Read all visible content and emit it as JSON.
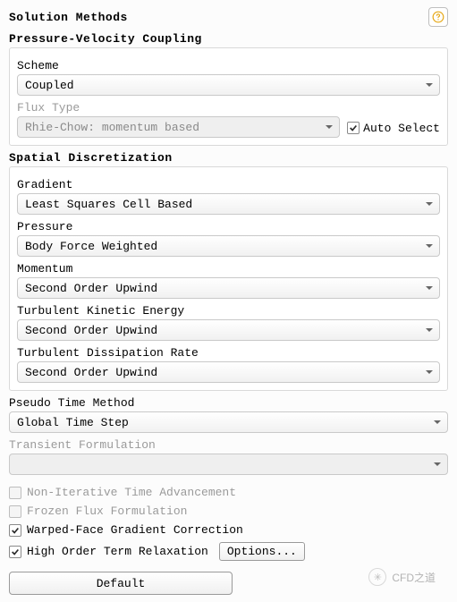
{
  "title": "Solution Methods",
  "pvc": {
    "title": "Pressure-Velocity Coupling",
    "scheme_label": "Scheme",
    "scheme_value": "Coupled",
    "flux_label": "Flux Type",
    "flux_value": "Rhie-Chow: momentum based",
    "auto_select_label": "Auto Select",
    "auto_select_checked": true
  },
  "sd": {
    "title": "Spatial Discretization",
    "gradient_label": "Gradient",
    "gradient_value": "Least Squares Cell Based",
    "pressure_label": "Pressure",
    "pressure_value": "Body Force Weighted",
    "momentum_label": "Momentum",
    "momentum_value": "Second Order Upwind",
    "tke_label": "Turbulent Kinetic Energy",
    "tke_value": "Second Order Upwind",
    "tdr_label": "Turbulent Dissipation Rate",
    "tdr_value": "Second Order Upwind"
  },
  "ptm": {
    "label": "Pseudo Time Method",
    "value": "Global Time Step"
  },
  "tf": {
    "label": "Transient Formulation",
    "value": ""
  },
  "checks": {
    "nita": "Non-Iterative Time Advancement",
    "fff": "Frozen Flux Formulation",
    "wfgc": "Warped-Face Gradient Correction",
    "hotr": "High Order Term Relaxation"
  },
  "options_btn": "Options...",
  "default_btn": "Default",
  "watermark": "CFD之道"
}
